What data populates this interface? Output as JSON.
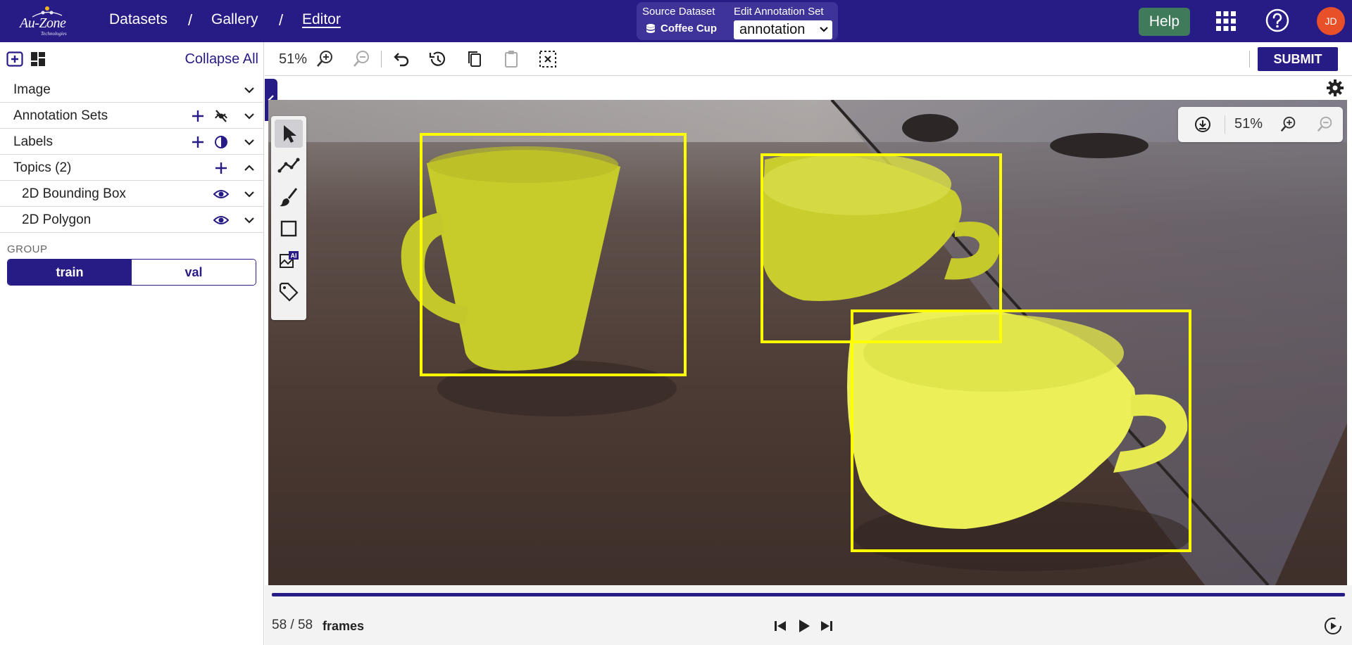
{
  "header": {
    "logo_text": "Au-Zone",
    "logo_sub": "Technologies",
    "breadcrumbs": [
      "Datasets",
      "Gallery",
      "Editor"
    ],
    "source_dataset_label": "Source Dataset",
    "source_dataset_value": "Coffee Cup",
    "edit_annotation_label": "Edit Annotation Set",
    "edit_annotation_value": "annotation",
    "help_label": "Help",
    "avatar_initials": "JD",
    "colors": {
      "bar": "#271b86",
      "help": "#3f7a5b",
      "avatar": "#e8502a"
    }
  },
  "left_panel": {
    "collapse_all": "Collapse All",
    "sections": [
      {
        "label": "Image"
      },
      {
        "label": "Annotation Sets"
      },
      {
        "label": "Labels"
      },
      {
        "label": "Topics (2)"
      }
    ],
    "topics": [
      {
        "label": "2D Bounding Box"
      },
      {
        "label": "2D Polygon"
      }
    ],
    "group_label": "GROUP",
    "group_options": [
      "train",
      "val"
    ],
    "group_selected": "train"
  },
  "toolbar": {
    "zoom": "51%",
    "submit_label": "SUBMIT"
  },
  "canvas": {
    "zoom": "51%",
    "annotation_color": "#ffff00",
    "tools": [
      "pointer-icon",
      "polyline-icon",
      "brush-icon",
      "rectangle-icon",
      "ai-image-icon",
      "tag-icon"
    ]
  },
  "timeline": {
    "frame_count": "58 / 58",
    "frames_label": "frames",
    "progress_fraction": 1.0
  }
}
